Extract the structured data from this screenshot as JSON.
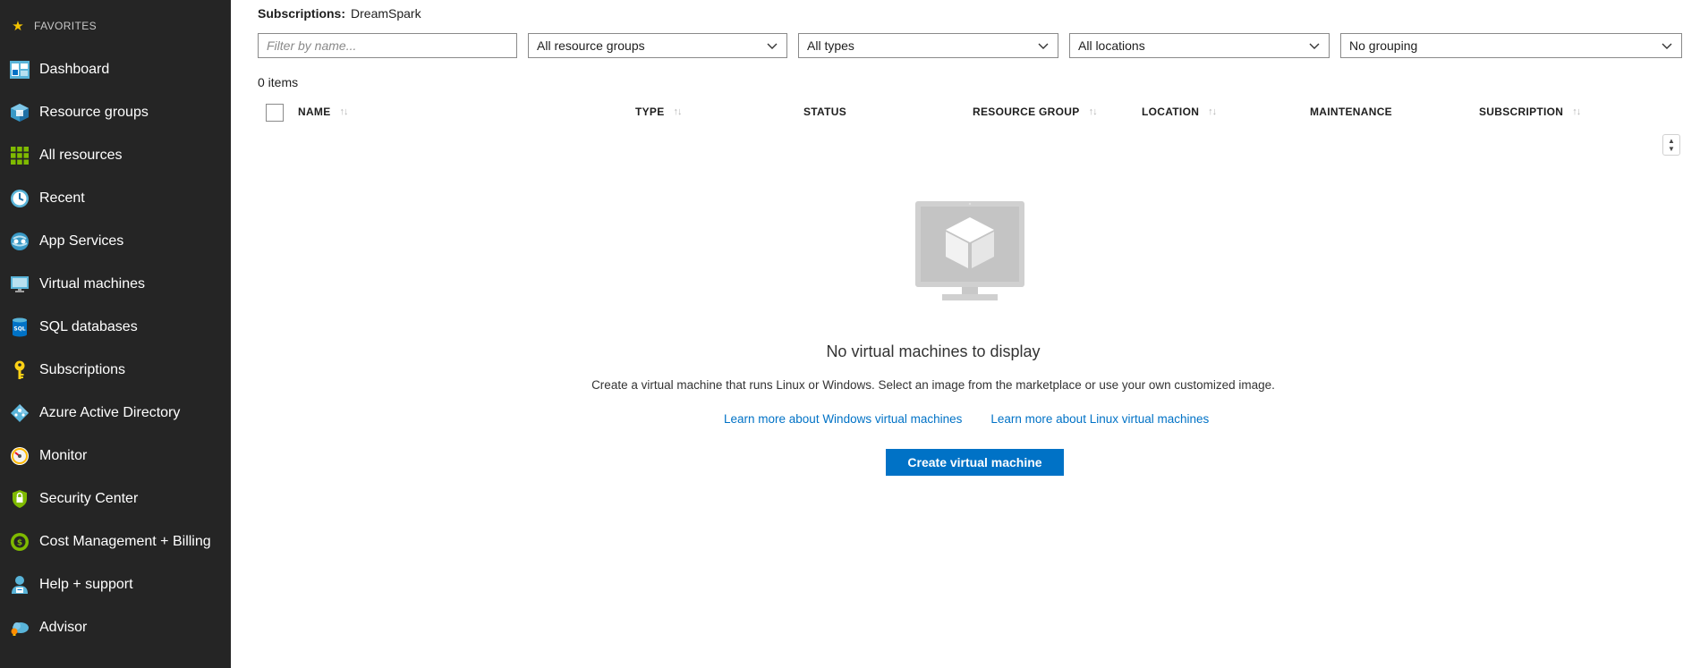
{
  "sidebar": {
    "favorites_label": "FAVORITES",
    "items": [
      {
        "label": "Dashboard",
        "icon": "dashboard-icon"
      },
      {
        "label": "Resource groups",
        "icon": "resource-groups-icon"
      },
      {
        "label": "All resources",
        "icon": "all-resources-icon"
      },
      {
        "label": "Recent",
        "icon": "recent-clock-icon"
      },
      {
        "label": "App Services",
        "icon": "app-services-icon"
      },
      {
        "label": "Virtual machines",
        "icon": "virtual-machines-icon"
      },
      {
        "label": "SQL databases",
        "icon": "sql-databases-icon"
      },
      {
        "label": "Subscriptions",
        "icon": "subscriptions-key-icon"
      },
      {
        "label": "Azure Active Directory",
        "icon": "azure-ad-icon"
      },
      {
        "label": "Monitor",
        "icon": "monitor-gauge-icon"
      },
      {
        "label": "Security Center",
        "icon": "security-center-icon"
      },
      {
        "label": "Cost Management + Billing",
        "icon": "cost-billing-icon"
      },
      {
        "label": "Help + support",
        "icon": "help-support-icon"
      },
      {
        "label": "Advisor",
        "icon": "advisor-icon"
      }
    ]
  },
  "main": {
    "subscriptions_key": "Subscriptions:",
    "subscriptions_value": "DreamSpark",
    "filter_placeholder": "Filter by name...",
    "dropdowns": {
      "resource_groups": "All resource groups",
      "types": "All types",
      "locations": "All locations",
      "grouping": "No grouping"
    },
    "item_count": "0 items",
    "columns": {
      "name": "NAME",
      "type": "TYPE",
      "status": "STATUS",
      "resource_group": "RESOURCE GROUP",
      "location": "LOCATION",
      "maintenance": "MAINTENANCE",
      "subscription": "SUBSCRIPTION"
    },
    "sort_glyph": "↑↓",
    "empty_state": {
      "title": "No virtual machines to display",
      "description": "Create a virtual machine that runs Linux or Windows. Select an image from the marketplace or use your own customized image.",
      "link_windows": "Learn more about Windows virtual machines",
      "link_linux": "Learn more about Linux virtual machines",
      "create_button": "Create virtual machine"
    }
  },
  "colors": {
    "sidebar_bg": "#252525",
    "accent_blue": "#0072c6",
    "star_yellow": "#f3c300"
  }
}
